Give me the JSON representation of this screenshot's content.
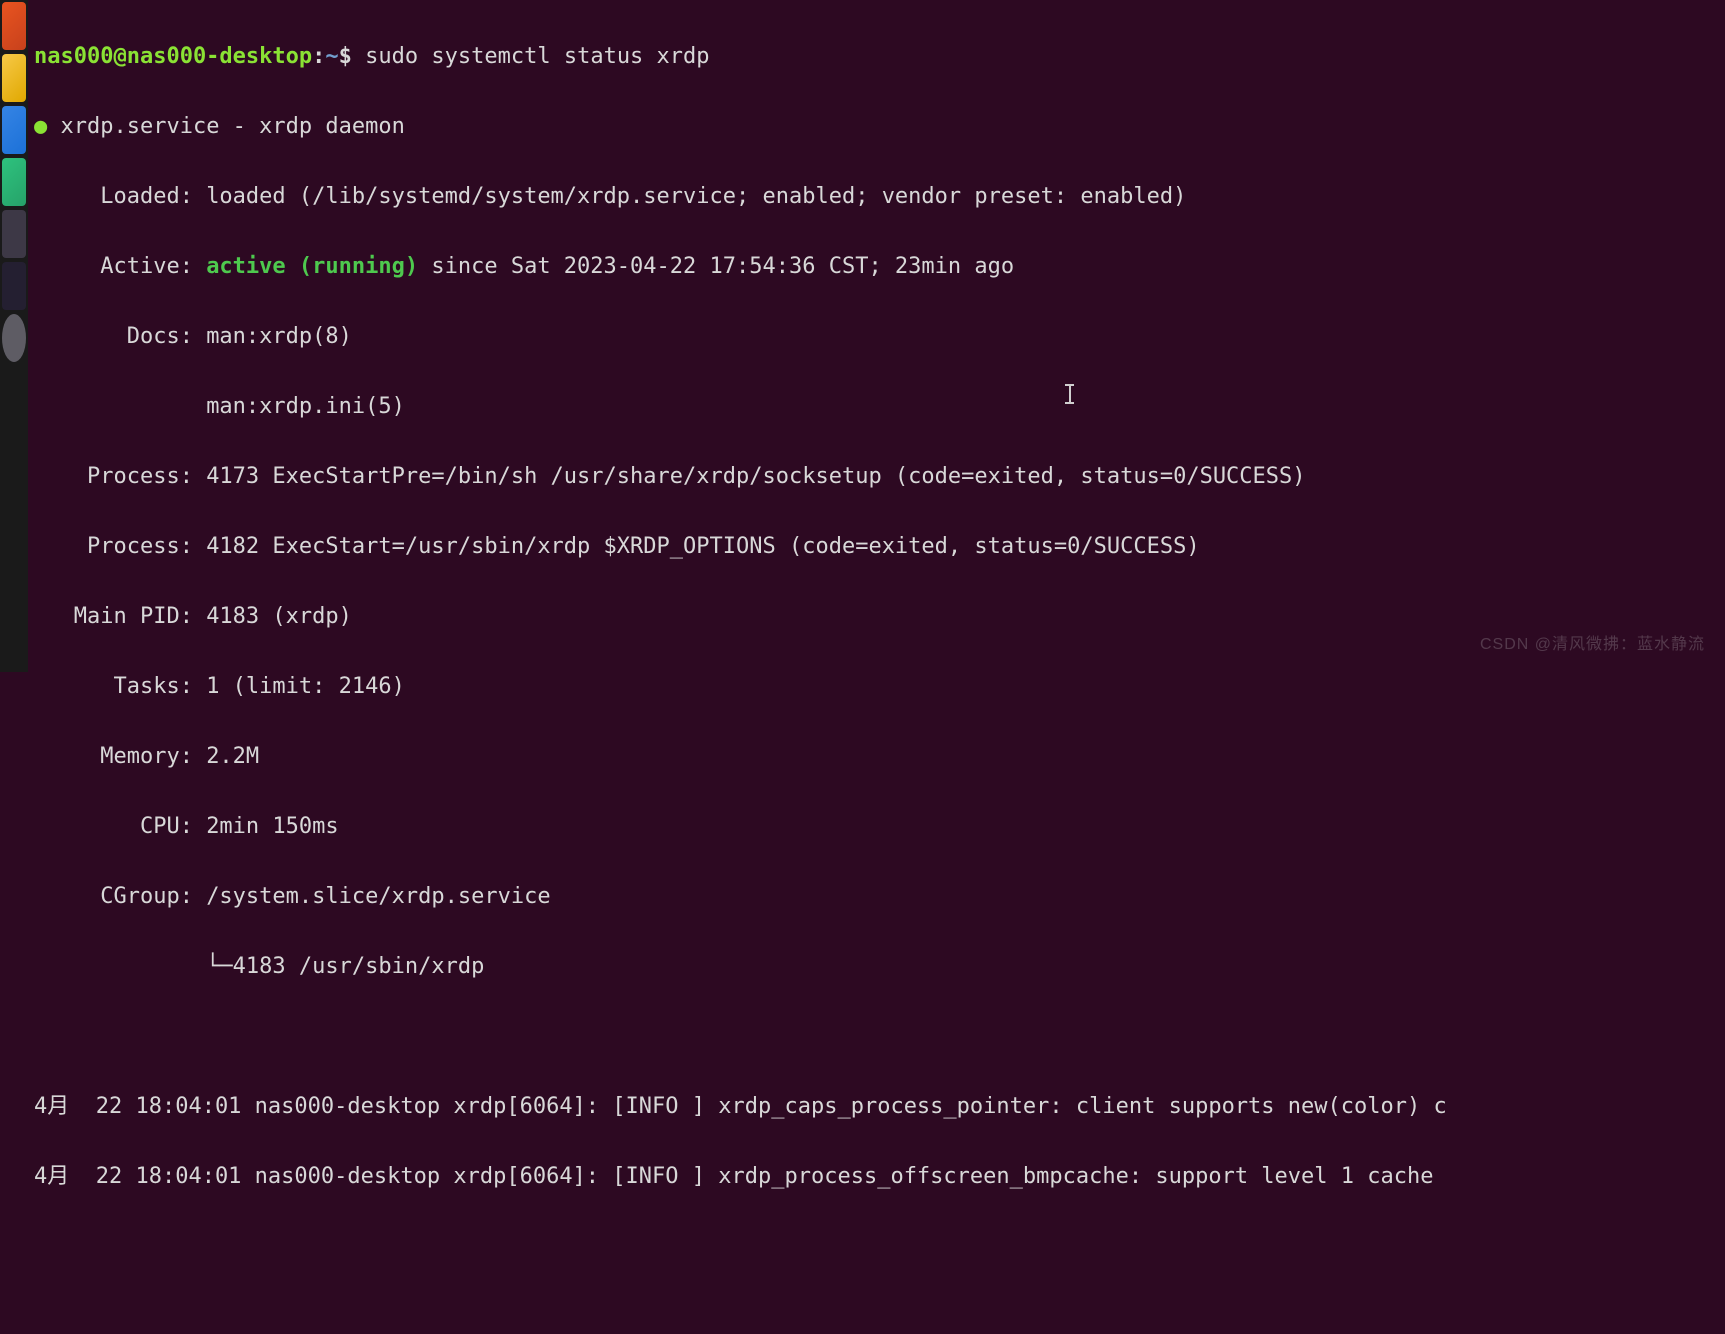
{
  "dock": {
    "items": [
      "files",
      "amazon",
      "settings",
      "help",
      "terminal",
      "dark",
      "apps"
    ]
  },
  "prompt": {
    "user_host": "nas000@nas000-desktop",
    "sep1": ":",
    "path": "~",
    "sep2": "$ ",
    "command": "sudo systemctl status xrdp"
  },
  "status": {
    "bullet": "●",
    "unit_line": " xrdp.service - xrdp daemon",
    "loaded_label": "     Loaded: ",
    "loaded_value": "loaded (/lib/systemd/system/xrdp.service; enabled; vendor preset: enabled)",
    "active_label": "     Active: ",
    "active_state": "active (running)",
    "active_since": " since Sat 2023-04-22 17:54:36 CST; 23min ago",
    "docs_label": "       Docs: ",
    "docs1": "man:xrdp(8)",
    "docs2_pad": "             ",
    "docs2": "man:xrdp.ini(5)",
    "proc1_label": "    Process: ",
    "proc1": "4173 ExecStartPre=/bin/sh /usr/share/xrdp/socksetup (code=exited, status=0/SUCCESS)",
    "proc2_label": "    Process: ",
    "proc2": "4182 ExecStart=/usr/sbin/xrdp $XRDP_OPTIONS (code=exited, status=0/SUCCESS)",
    "mainpid_label": "   Main PID: ",
    "mainpid": "4183 (xrdp)",
    "tasks_label": "      Tasks: ",
    "tasks": "1 (limit: 2146)",
    "memory_label": "     Memory: ",
    "memory": "2.2M",
    "cpu_label": "        CPU: ",
    "cpu": "2min 150ms",
    "cgroup_label": "     CGroup: ",
    "cgroup": "/system.slice/xrdp.service",
    "cgroup_tree": "             └─4183 /usr/sbin/xrdp"
  },
  "logs": {
    "l1": "4月  22 18:04:01 nas000-desktop xrdp[6064]: [INFO ] xrdp_caps_process_pointer: client supports new(color) c",
    "l2": "4月  22 18:04:01 nas000-desktop xrdp[6064]: [INFO ] xrdp_process_offscreen_bmpcache: support level 1 cache"
  },
  "watermark": "CSDN @清风微拂：蓝水静流"
}
